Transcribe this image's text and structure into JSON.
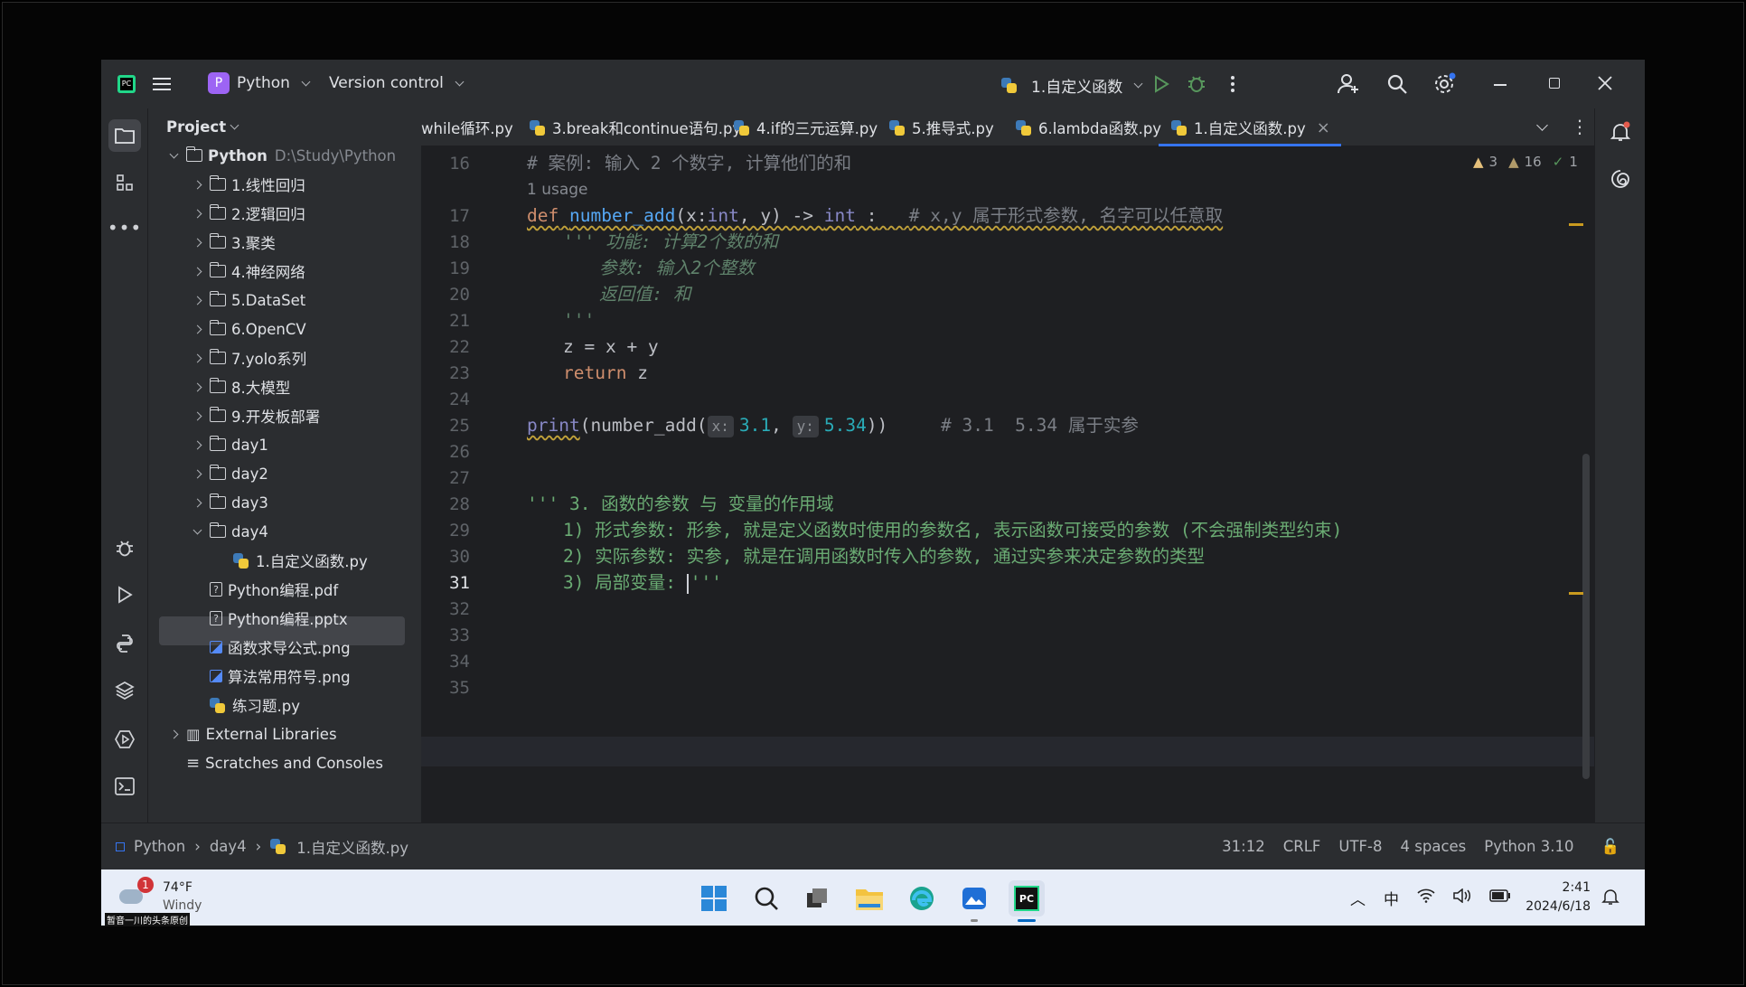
{
  "titlebar": {
    "project_badge": "P",
    "project_name": "Python",
    "vcs": "Version control",
    "run_config": "1.自定义函数"
  },
  "project_panel": {
    "header": "Project",
    "root_name": "Python",
    "root_path": "D:\\Study\\Python",
    "folders": [
      "1.线性回归",
      "2.逻辑回归",
      "3.聚类",
      "4.神经网络",
      "5.DataSet",
      "6.OpenCV",
      "7.yolo系列",
      "8.大模型",
      "9.开发板部署",
      "day1",
      "day2",
      "day3",
      "day4"
    ],
    "files": [
      "1.自定义函数.py",
      "Python编程.pdf",
      "Python编程.pptx",
      "函数求导公式.png",
      "算法常用符号.png",
      "练习题.py"
    ],
    "external": "External Libraries",
    "scratches": "Scratches and Consoles"
  },
  "tabs": [
    "while循环.py",
    "3.break和continue语句.py",
    "4.if的三元运算.py",
    "5.推导式.py",
    "6.lambda函数.py",
    "1.自定义函数.py"
  ],
  "inspections": {
    "warn_a": "3",
    "warn_b": "16",
    "ok": "1"
  },
  "editor": {
    "usage": "1 usage",
    "lines": [
      "16",
      "17",
      "18",
      "19",
      "20",
      "21",
      "22",
      "23",
      "24",
      "25",
      "26",
      "27",
      "28",
      "29",
      "30",
      "31",
      "32",
      "33",
      "34",
      "35"
    ],
    "l16": "# 案例: 输入 2 个数字, 计算他们的和",
    "l17_def": "def",
    "l17_fn": "number_add",
    "l17_sig_a": "(x:",
    "l17_int1": "int",
    "l17_sig_b": ", y) -> ",
    "l17_int2": "int",
    "l17_sig_c": " :",
    "l17_cm": "# x,y 属于形式参数, 名字可以任意取",
    "l18": "''' 功能: 计算2个数的和",
    "l19": "参数: 输入2个整数",
    "l20": "返回值: 和",
    "l21": "'''",
    "l22": "z = x + y",
    "l23_kw": "return",
    "l23_rest": " z",
    "l25_print": "print",
    "l25_a": "(number_add(",
    "l25_hx": "x:",
    "l25_n1": "3.1",
    "l25_comma": ", ",
    "l25_hy": "y:",
    "l25_n2": "5.34",
    "l25_b": "))",
    "l25_cm": "# 3.1  5.34 属于实参",
    "l28": "''' 3. 函数的参数 与 变量的作用域",
    "l29": "1) 形式参数: 形参, 就是定义函数时使用的参数名, 表示函数可接受的参数 (不会强制类型约束)",
    "l30": "2) 实际参数: 实参, 就是在调用函数时传入的参数, 通过实参来决定参数的类型",
    "l31_a": "3) 局部变量: ",
    "l31_b": "'''"
  },
  "breadcrumb": [
    "Python",
    "day4",
    "1.自定义函数.py"
  ],
  "status": {
    "position": "31:12",
    "line_sep": "CRLF",
    "encoding": "UTF-8",
    "indent": "4 spaces",
    "interpreter": "Python 3.10"
  },
  "taskbar": {
    "weather_temp": "74°F",
    "weather_desc": "Windy",
    "weather_badge": "1",
    "watermark": "暂音一川的头条原创",
    "ime": "中",
    "time": "2:41",
    "date": "2024/6/18"
  },
  "colors": {
    "accent": "#3574f0",
    "keyword": "#cf8e6d",
    "function": "#56a8f5",
    "docstring": "#5f826b",
    "number": "#2aacb8"
  }
}
